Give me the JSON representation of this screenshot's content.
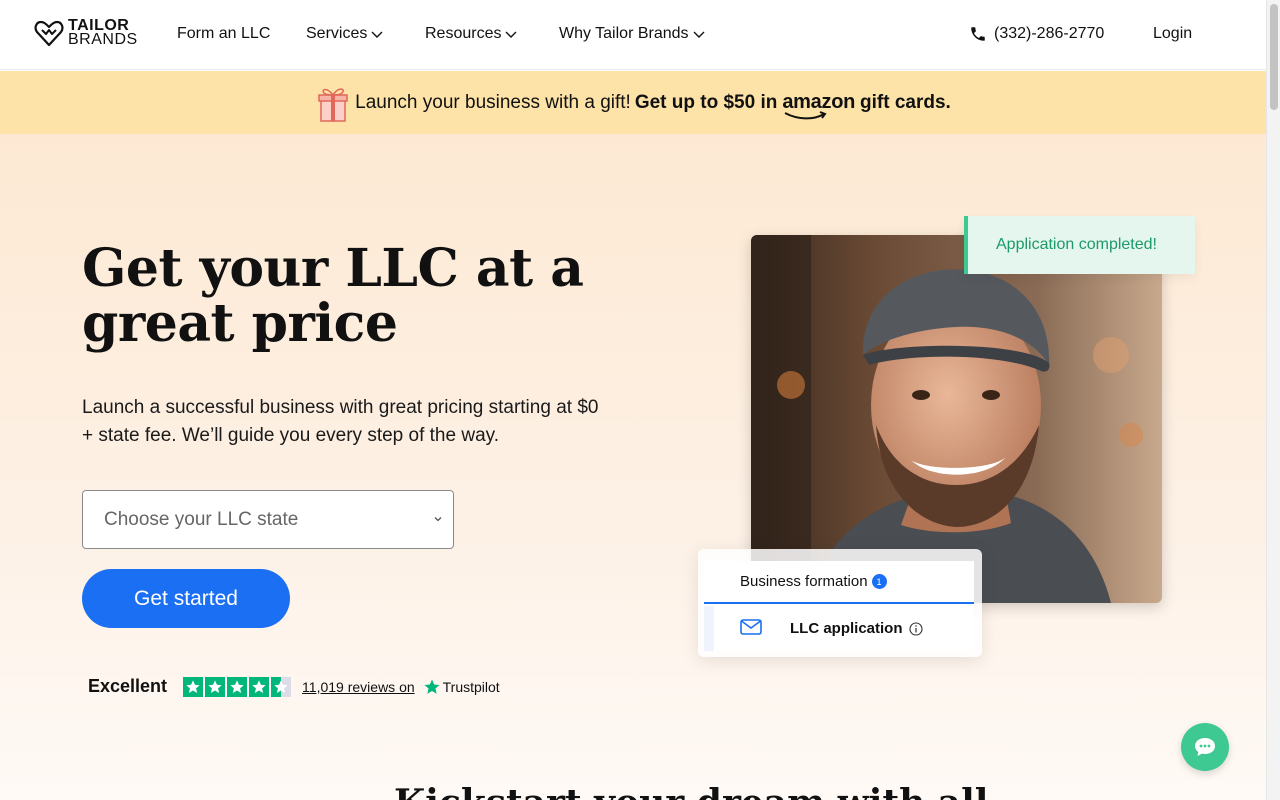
{
  "header": {
    "logo_line1": "TAILOR",
    "logo_line2": "BRANDS",
    "nav": [
      {
        "label": "Form an LLC",
        "has_dropdown": false
      },
      {
        "label": "Services",
        "has_dropdown": true
      },
      {
        "label": "Resources",
        "has_dropdown": true
      },
      {
        "label": "Why Tailor Brands",
        "has_dropdown": true
      }
    ],
    "phone": "(332)-286-2770",
    "login": "Login"
  },
  "promo": {
    "text": "Launch your business with a gift!",
    "bold_text": "Get up to $50 in",
    "brand": "amazon",
    "suffix": "gift cards."
  },
  "hero": {
    "title": "Get your LLC at a great price",
    "subtitle": "Launch a successful business with great pricing starting at $0 + state fee. We’ll guide you every step of the way.",
    "select_placeholder": "Choose your LLC state",
    "cta": "Get started",
    "rating_label": "Excellent",
    "rating_stars": 4.5,
    "reviews": "11,019 reviews on",
    "review_site": "Trustpilot"
  },
  "card": {
    "toast": "Application completed!",
    "tab": "Business formation",
    "tab_badge": "1",
    "row": "LLC application"
  },
  "next_section": {
    "heading": "Kickstart your dream with all"
  },
  "colors": {
    "accent": "#1a6ff2",
    "promo_bg": "#fde3a7",
    "success": "#3dc991",
    "trustpilot": "#00b67a"
  }
}
